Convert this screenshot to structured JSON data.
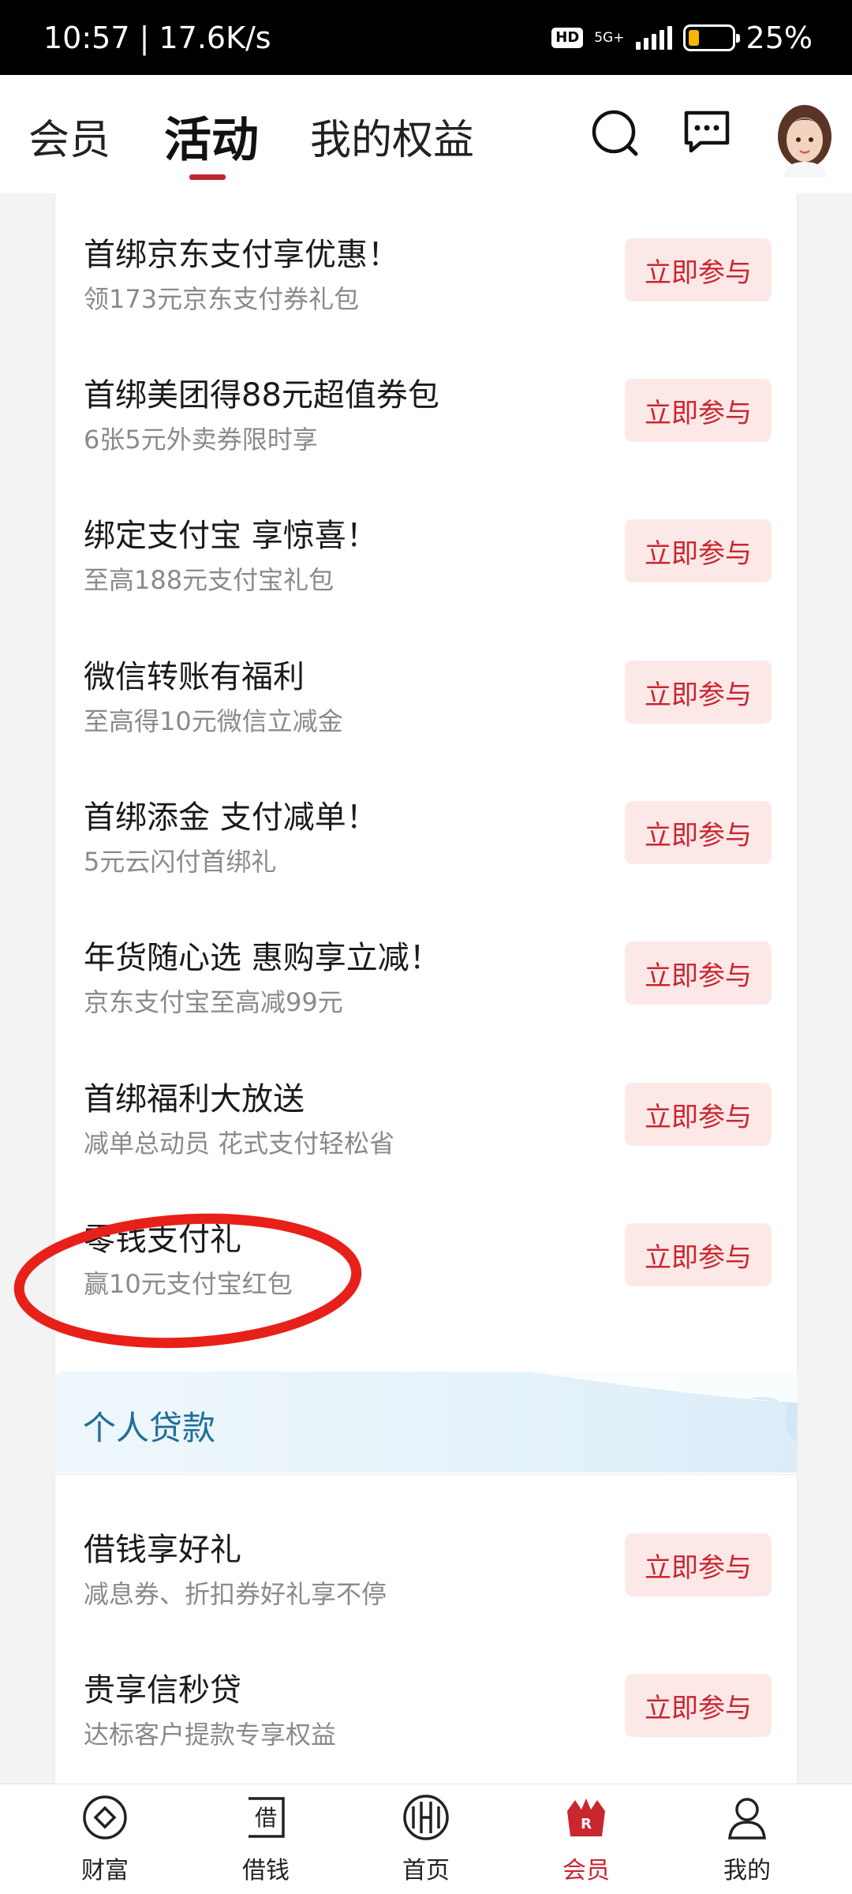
{
  "status_bar": {
    "time": "10:57 | 17.6K/s",
    "hd": "HD",
    "network": "5G+",
    "battery": "25%",
    "battery_level": 0.25
  },
  "header": {
    "tabs": [
      "会员",
      "活动",
      "我的权益"
    ],
    "active_tab": "活动"
  },
  "activities": [
    {
      "title": "首绑京东支付享优惠！",
      "subtitle": "领173元京东支付券礼包",
      "button": "立即参与"
    },
    {
      "title": "首绑美团得88元超值券包",
      "subtitle": "6张5元外卖券限时享",
      "button": "立即参与"
    },
    {
      "title": "绑定支付宝 享惊喜！",
      "subtitle": "至高188元支付宝礼包",
      "button": "立即参与"
    },
    {
      "title": "微信转账有福利",
      "subtitle": "至高得10元微信立减金",
      "button": "立即参与"
    },
    {
      "title": "首绑添金 支付减单！",
      "subtitle": "5元云闪付首绑礼",
      "button": "立即参与"
    },
    {
      "title": "年货随心选 惠购享立减！",
      "subtitle": "京东支付宝至高减99元",
      "button": "立即参与"
    },
    {
      "title": "首绑福利大放送",
      "subtitle": "减单总动员 花式支付轻松省",
      "button": "立即参与"
    },
    {
      "title": "零钱支付礼",
      "subtitle": "赢10元支付宝红包",
      "button": "立即参与"
    }
  ],
  "loan_section": {
    "title": "个人贷款",
    "items": [
      {
        "title": "借钱享好礼",
        "subtitle": "减息券、折扣券好礼享不停",
        "button": "立即参与"
      },
      {
        "title": "贵享信秒贷",
        "subtitle": "达标客户提款专享权益",
        "button": "立即参与"
      }
    ]
  },
  "bottom_nav": {
    "items": [
      {
        "label": "财富",
        "icon": "wealth-icon"
      },
      {
        "label": "借钱",
        "icon": "borrow-icon"
      },
      {
        "label": "首页",
        "icon": "home-icon"
      },
      {
        "label": "会员",
        "icon": "member-icon"
      },
      {
        "label": "我的",
        "icon": "profile-icon"
      }
    ],
    "active": "会员"
  },
  "colors": {
    "accent_red": "#c9262f",
    "button_bg": "#fde8e8",
    "annotation_red": "#e8201a",
    "loan_title_blue": "#1e6e9a"
  }
}
